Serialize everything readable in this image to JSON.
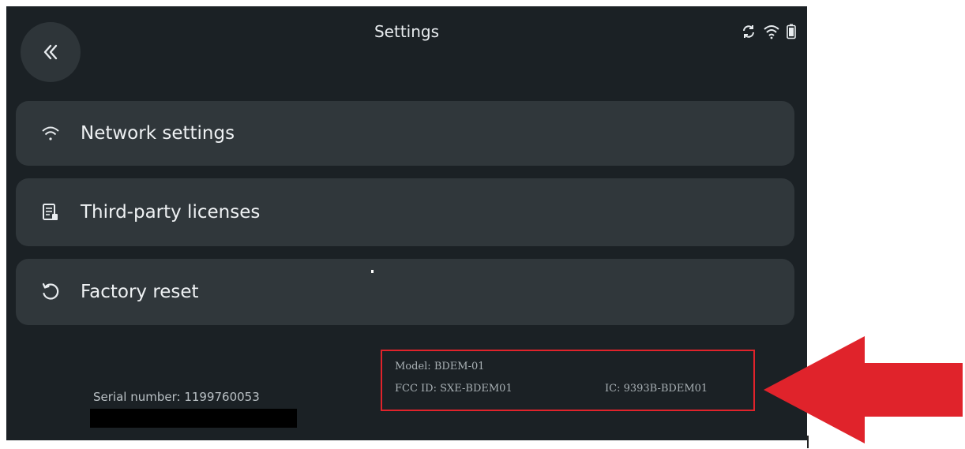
{
  "header": {
    "title": "Settings"
  },
  "status_icons": [
    "sync-icon",
    "wifi-icon",
    "battery-icon"
  ],
  "menu": [
    {
      "label": "Network settings",
      "icon": "wifi-icon"
    },
    {
      "label": "Third-party licenses",
      "icon": "document-icon"
    },
    {
      "label": "Factory reset",
      "icon": "reset-icon"
    }
  ],
  "footer": {
    "serial": "Serial number: 1199760053",
    "model": "Model: BDEM-01",
    "fcc_id": "FCC ID: SXE-BDEM01",
    "ic": "IC: 9393B-BDEM01"
  },
  "colors": {
    "background": "#1b2125",
    "card": "#30373b",
    "highlight": "#e0232b"
  }
}
